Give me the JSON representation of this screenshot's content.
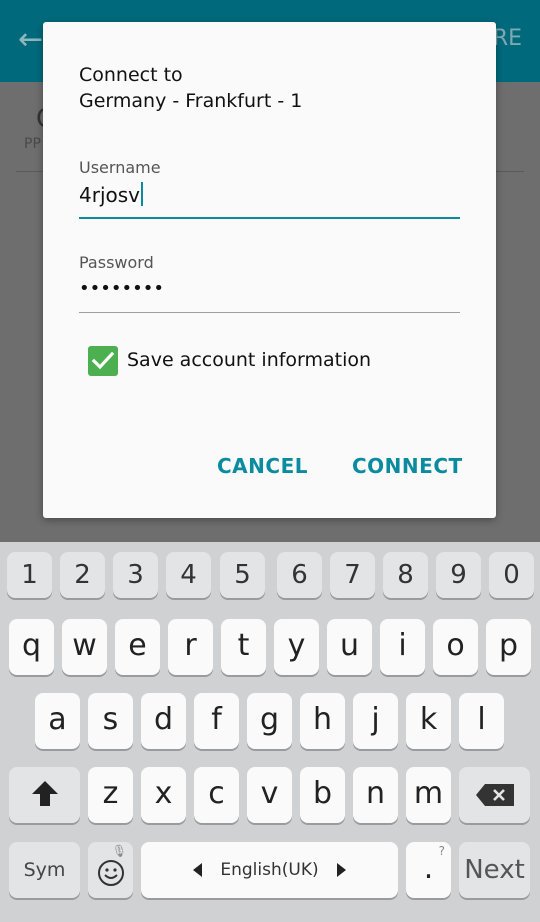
{
  "background": {
    "appbar_action": "RE",
    "list_letter": "C",
    "list_sub": "PP"
  },
  "dialog": {
    "title_line1": "Connect to",
    "title_line2": "Germany - Frankfurt - 1",
    "username_label": "Username",
    "username_value": "4rjosv",
    "password_label": "Password",
    "password_value": "••••••••",
    "save_label": "Save account information",
    "save_checked": true,
    "cancel_label": "CANCEL",
    "connect_label": "CONNECT"
  },
  "keyboard": {
    "numbers": [
      "1",
      "2",
      "3",
      "4",
      "5",
      "6",
      "7",
      "8",
      "9",
      "0"
    ],
    "row1": [
      "q",
      "w",
      "e",
      "r",
      "t",
      "y",
      "u",
      "i",
      "o",
      "p"
    ],
    "row2": [
      "a",
      "s",
      "d",
      "f",
      "g",
      "h",
      "j",
      "k",
      "l"
    ],
    "row3": [
      "z",
      "x",
      "c",
      "v",
      "b",
      "n",
      "m"
    ],
    "sym_label": "Sym",
    "space_label": "English(UK)",
    "period_label": ".",
    "period_hint": "?",
    "next_label": "Next"
  },
  "colors": {
    "accent": "#0a8ba0",
    "checkbox": "#4caf50",
    "app_bar": "#006a7c"
  }
}
